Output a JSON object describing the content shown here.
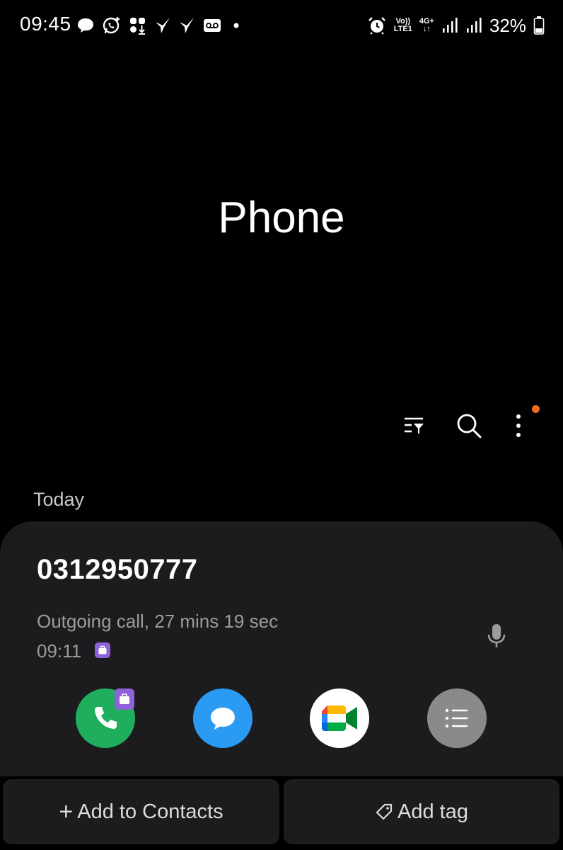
{
  "status_bar": {
    "time": "09:45",
    "net_top": "Vo))",
    "net_bottom": "LTE1",
    "gen_top": "4G+",
    "gen_bottom": "↓↑",
    "battery": "32%",
    "left_icons": [
      "chat-bubble-icon",
      "whatsapp-icon",
      "app-grid-download-icon",
      "bird-icon",
      "bird-icon",
      "voicemail-icon",
      "dot-icon"
    ],
    "right_icons": [
      "alarm-icon",
      "signal-icon",
      "signal-icon",
      "battery-icon"
    ]
  },
  "header": {
    "title": "Phone"
  },
  "toolbar": {
    "icons": [
      "filter-icon",
      "search-icon",
      "more-options-icon"
    ],
    "notification_color": "#f26b21"
  },
  "section": {
    "label": "Today"
  },
  "call_entry": {
    "number": "0312950777",
    "detail": "Outgoing call, 27 mins 19 sec",
    "time": "09:11",
    "actions": [
      "call",
      "message",
      "video-call",
      "details"
    ],
    "colors": {
      "call": "#1fae5e",
      "message": "#2b9af3",
      "details": "#8a8a8a",
      "sim_badge": "#8e63d8"
    }
  },
  "bottom_actions": {
    "add_contacts_plus": "+",
    "add_contacts": "Add to Contacts",
    "add_tag": "Add tag"
  }
}
